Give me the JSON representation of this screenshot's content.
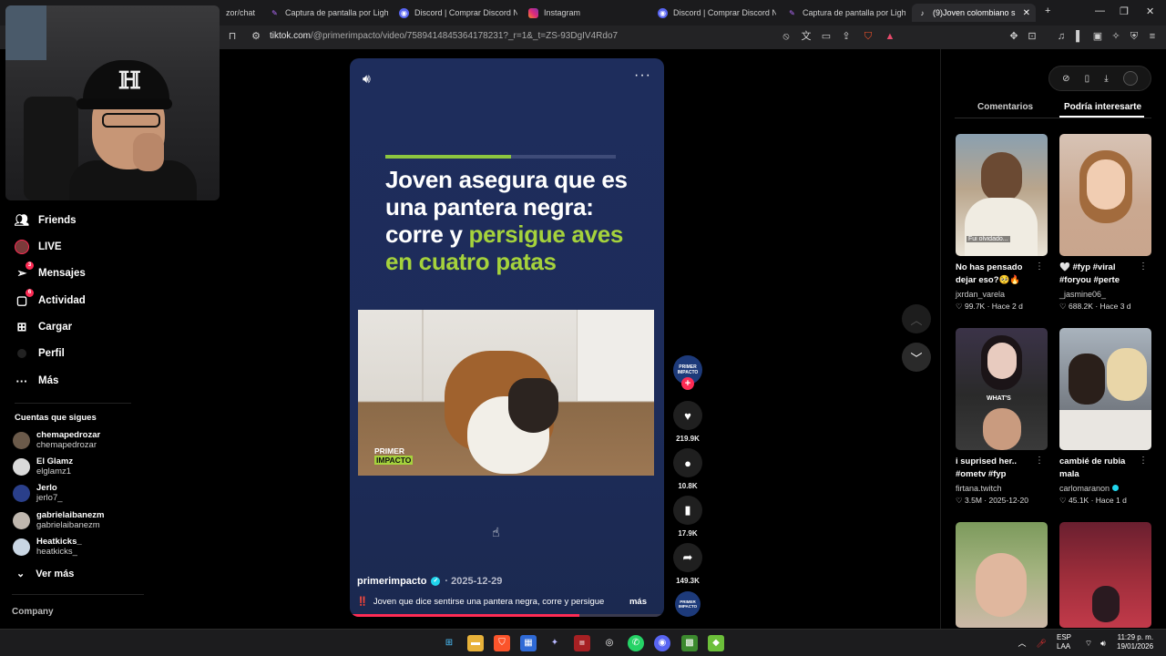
{
  "browser": {
    "tabs": [
      {
        "label": "zor/chat",
        "icon": "web-icon",
        "active": false
      },
      {
        "label": "Captura de pantalla por Lightsh",
        "icon": "feather-icon",
        "active": false
      },
      {
        "label": "Discord | Comprar Discord Nitr",
        "icon": "discord-icon",
        "active": false
      },
      {
        "label": "Instagram",
        "icon": "instagram-icon",
        "active": false
      },
      {
        "label": "Discord | Comprar Discord Nitr",
        "icon": "discord-icon",
        "active": false
      },
      {
        "label": "Captura de pantalla por Lightsh",
        "icon": "feather-icon",
        "active": false
      },
      {
        "label": "(9)Joven colombiano s",
        "icon": "tiktok-icon",
        "active": true
      }
    ],
    "new_tab": "+",
    "url_host": "tiktok.com",
    "url_path": "/@primerimpacto/video/7589414845364178231?_r=1&_t=ZS-93DgIV4Rdo7"
  },
  "sidebar": {
    "items": [
      {
        "label": "Friends",
        "icon": "friends-icon",
        "badge": ""
      },
      {
        "label": "LIVE",
        "icon": "live-icon",
        "badge": ""
      },
      {
        "label": "Mensajes",
        "icon": "messages-icon",
        "badge": "3"
      },
      {
        "label": "Actividad",
        "icon": "activity-icon",
        "badge": "6"
      },
      {
        "label": "Cargar",
        "icon": "upload-icon",
        "badge": ""
      },
      {
        "label": "Perfil",
        "icon": "profile-icon",
        "badge": ""
      },
      {
        "label": "Más",
        "icon": "more-icon",
        "badge": ""
      }
    ],
    "following_title": "Cuentas que sigues",
    "following": [
      {
        "name": "chemapedrozar",
        "handle": "chemapedrozar",
        "color": "#6b5a4a"
      },
      {
        "name": "El Glamz",
        "handle": "elglamz1",
        "color": "#d9d9d9"
      },
      {
        "name": "Jerlo",
        "handle": "jerlo7_",
        "color": "#2a3f8a"
      },
      {
        "name": "gabrielaibanezm",
        "handle": "gabrielaibanezm",
        "color": "#bfb7ae"
      },
      {
        "name": "Heatkicks_",
        "handle": "heatkicks_",
        "color": "#c9d6e3"
      }
    ],
    "see_more": "Ver más",
    "company": "Company"
  },
  "video": {
    "headline_white": "Joven asegura que es una pantera negra: corre y ",
    "headline_green": "persigue aves en cuatro patas",
    "logo_line1": "PRIMER",
    "logo_line2": "IMPACTO",
    "author": "primerimpacto",
    "date": "· 2025-12-29",
    "caption_mark": "‼️",
    "caption": "Joven que dice sentirse una pantera negra, corre y persigue",
    "more": "más",
    "progress": 0.73
  },
  "actions": {
    "creator_label": "PRIMER IMPACTO",
    "likes": "219.9K",
    "comments": "10.8K",
    "saves": "17.9K",
    "shares": "149.3K"
  },
  "right_panel": {
    "tab_comments": "Comentarios",
    "tab_suggested": "Podría interesarte",
    "thumb_caption_1": "Fui olvidado...",
    "thumb_caption_3": "WHAT'S",
    "recs": [
      {
        "title": "No has pensado dejar eso?🥺🔥",
        "user": "jxrdan_varela",
        "likes": "99.7K",
        "age": "Hace 2 d",
        "c1": "#8aa0b0",
        "c2": "#e9e3d6"
      },
      {
        "title": "🤍 #fyp #viral #foryou #perte",
        "user": "_jasmine06_",
        "likes": "688.2K",
        "age": "Hace 3 d",
        "c1": "#d7c3b5",
        "c2": "#c9a58d"
      },
      {
        "title": "i suprised her.. #ometv #fyp",
        "user": "firtana.twitch",
        "likes": "3.5M",
        "age": "2025-12-20",
        "c1": "#3b3348",
        "c2": "#2a2a2a"
      },
      {
        "title": "cambié de rubia mala",
        "user": "carlomaranon",
        "likes": "45.1K",
        "age": "Hace 1 d",
        "c1": "#a9b3bd",
        "c2": "#5a5f66"
      },
      {
        "title": "",
        "user": "",
        "likes": "",
        "age": "",
        "c1": "#7c9a5c",
        "c2": "#cdb9a8"
      },
      {
        "title": "",
        "user": "",
        "likes": "",
        "age": "",
        "c1": "#6a1f2f",
        "c2": "#c23a4a"
      }
    ]
  },
  "taskbar": {
    "lang1": "ESP",
    "lang2": "LAA",
    "time": "11:29 p. m.",
    "date": "19/01/2026"
  },
  "colors": {
    "accent": "#fe2c55",
    "headline_green": "#a5d23c",
    "video_bg": "#1e2d5c"
  }
}
